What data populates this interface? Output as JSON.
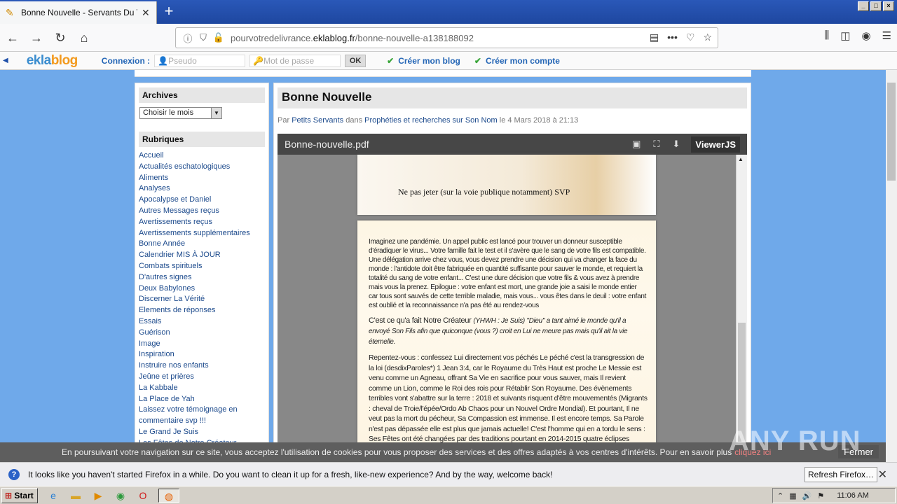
{
  "browser": {
    "tab_title": "Bonne Nouvelle - Servants Du Trè",
    "url_prefix": "pourvotredelivrance.",
    "url_domain": "eklablog.fr",
    "url_path": "/bonne-nouvelle-a138188092"
  },
  "eklablog": {
    "logo_main": "ekla",
    "logo_accent": "blog",
    "connexion_label": "Connexion :",
    "pseudo_placeholder": "Pseudo",
    "password_placeholder": "Mot de passe",
    "ok_label": "OK",
    "create_blog": "Créer mon blog",
    "create_account": "Créer mon compte"
  },
  "sidebar": {
    "archives_title": "Archives",
    "month_select": "Choisir le mois",
    "rubriques_title": "Rubriques",
    "items": [
      "Accueil",
      "Actualités eschatologiques",
      "Aliments",
      "Analyses",
      "Apocalypse et Daniel",
      "Autres Messages reçus",
      "Avertissements reçus",
      "Avertissements supplémentaires",
      "Bonne Année",
      "Calendrier MIS À JOUR",
      "Combats spirituels",
      "D'autres signes",
      "Deux Babylones",
      "Discerner La Vérité",
      "Elements de réponses",
      "Essais",
      "Guérison",
      "Image",
      "Inspiration",
      "Instruire nos enfants",
      "Jeûne et prières",
      "La Kabbale",
      "La Place de Yah",
      "Laissez votre témoignage en",
      "commentaire svp !!!",
      "Le Grand Je Suis",
      "Les Fêtes de Notre Créateur"
    ]
  },
  "post": {
    "title": "Bonne Nouvelle",
    "meta_par": "Par",
    "author": "Petits Servants",
    "meta_dans": "dans",
    "category": "Prophéties et recherches sur Son Nom",
    "meta_date": "le 4 Mars 2018 à 21:13"
  },
  "viewer": {
    "filename": "Bonne-nouvelle.pdf",
    "brand": "ViewerJS",
    "page1_text": "Ne pas jeter (sur la voie publique notamment) SVP",
    "page2_p1": "Imaginez une pandémie. Un appel public est lancé pour trouver un donneur susceptible d'éradiquer le virus... Votre famille fait le test et il s'avère que le sang de votre fils est compatible. Une délégation arrive chez vous, vous devez prendre une décision qui va changer la face du monde : l'antidote doit être fabriquée en quantité suffisante pour sauver le monde, et requiert la totalité du sang de votre enfant... C'est une dure décision que votre fils & vous avez à prendre mais vous la prenez. Epilogue : votre enfant est mort, une grande joie a saisi le monde entier car tous sont sauvés de cette terrible maladie, mais vous... vous êtes dans le deuil : votre enfant est oublié et la reconnaissance n'a pas été au rendez-vous",
    "page2_p2_main": "C'est ce qu'a fait Notre Créateur",
    "page2_p2_italic": "(YHWH : Je Suis) \"Dieu\" a tant aimé le monde qu'il a envoyé Son Fils afin que quiconque (vous ?) croit en Lui ne meure pas mais qu'il ait la vie éternelle.",
    "page2_p3": "Repentez-vous : confessez Lui directement vos péchés Le péché c'est la transgression de la loi (desdixParoles*) 1 Jean 3:4, car le Royaume du Très Haut est proche Le Messie est venu comme un Agneau, offrant Sa Vie en sacrifice pour vous sauver, mais Il revient comme un Lion, comme le Roi des rois pour Rétablir Son Royaume. Des évènements terribles vont s'abattre sur la terre : 2018 et suivants risquent d'être mouvementés (Migrants : cheval de Troie/l'épée/Ordo Ab Chaos pour un Nouvel Ordre Mondial). Et pourtant, Il ne veut pas la mort du pécheur, Sa Compassion est immense. Il est encore temps. Sa Parole n'est pas dépassée elle est plus que jamais actuelle! C'est l'homme qui en a tordu le sens : Ses Fêtes ont été changées par des traditions pourtant en 2014-2015 quatre éclipses solaires et lunaires ont eu lieu à chacun des Ses temps marqués... qui en disent long sur les temps de La Fin prophétisés dans Les Écritures. Votre"
  },
  "cookie": {
    "text": "En poursuivant votre navigation sur ce site, vous acceptez l'utilisation de cookies pour vous proposer des services et des offres adaptés à vos centres d'intérêts. Pour en savoir plus",
    "more": "cliquez ici",
    "close": "Fermer"
  },
  "watermark": "ANY RUN",
  "notification": {
    "text": "It looks like you haven't started Firefox in a while. Do you want to clean it up for a fresh, like-new experience? And by the way, welcome back!",
    "button": "Refresh Firefox…"
  },
  "taskbar": {
    "start": "Start",
    "clock": "11:06 AM"
  },
  "colors": {
    "page_bg": "#6fa9ea",
    "link": "#1c4a8c",
    "ekla_blue": "#2466b6"
  }
}
